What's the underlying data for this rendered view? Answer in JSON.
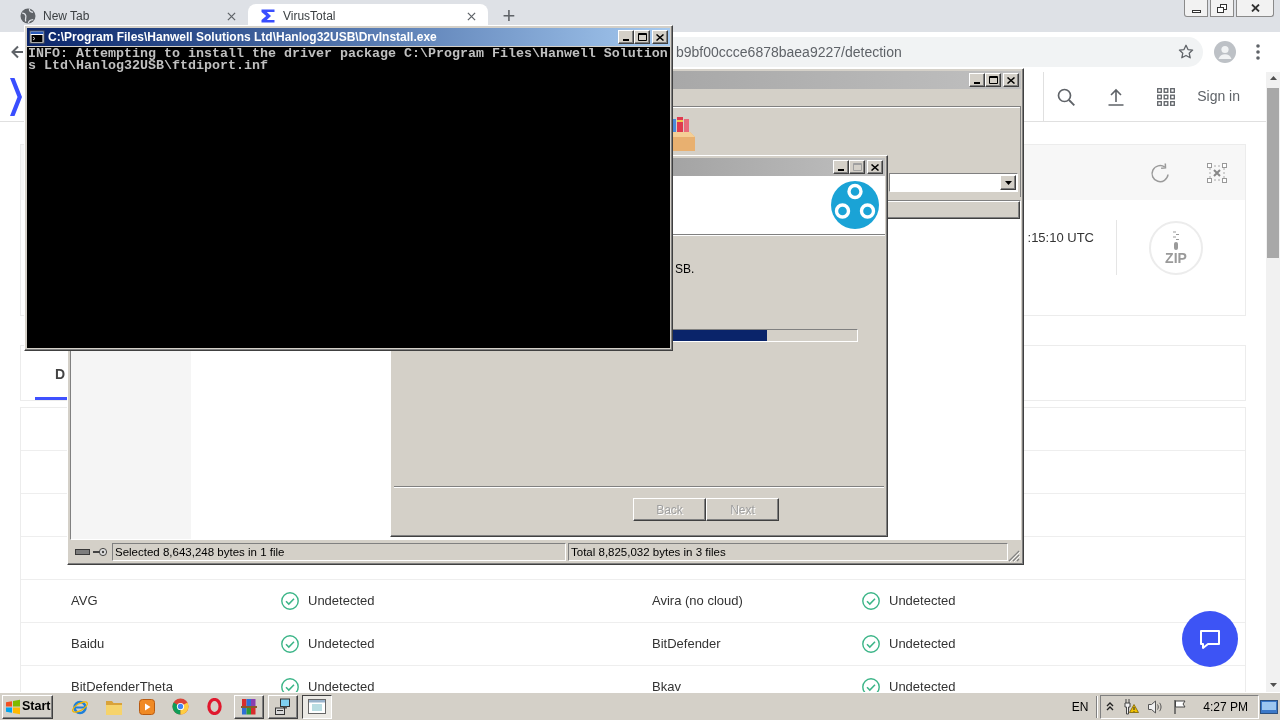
{
  "browser": {
    "tabs": [
      {
        "title": "New Tab",
        "selected": false
      },
      {
        "title": "VirusTotal",
        "selected": true
      }
    ],
    "new_tab": "+",
    "url": "b9bf00ccce6878baea9227/detection"
  },
  "page": {
    "sign_in": "Sign in",
    "summary": {
      "date": ":15:10 UTC",
      "file_type": "ZIP"
    },
    "tabs": [
      {
        "label": "D",
        "selected": true
      }
    ],
    "results": [
      {
        "cells": [
          {
            "engine": "AVG",
            "result": "Undetected"
          },
          {
            "engine": "Avira (no cloud)",
            "result": "Undetected"
          }
        ]
      },
      {
        "cells": [
          {
            "engine": "Baidu",
            "result": "Undetected"
          },
          {
            "engine": "BitDefender",
            "result": "Undetected"
          }
        ]
      },
      {
        "cells": [
          {
            "engine": "BitDefenderTheta",
            "result": "Undetected"
          },
          {
            "engine": "Bkav",
            "result": "Undetected"
          }
        ]
      }
    ]
  },
  "archive_window": {
    "active": false,
    "status": [
      "Selected 8,643,248 bytes in 1 file",
      "Total 8,825,032 bytes in 3 files"
    ]
  },
  "installer_window": {
    "active": false,
    "maximize_disabled": true,
    "message": "SB.",
    "progress": {
      "level": 0.51
    },
    "buttons": [
      {
        "label": "Back",
        "disabled": true
      },
      {
        "label": "Next",
        "disabled": true
      }
    ]
  },
  "console_window": {
    "active": true,
    "title": "C:\\Program Files\\Hanwell Solutions Ltd\\Hanlog32USB\\DrvInstall.exe",
    "lines": [
      "INFO: Attempting to install the driver package C:\\Program Files\\Hanwell Solution",
      "s Ltd\\Hanlog32USB\\ftdiport.inf"
    ]
  },
  "taskbar": {
    "start": "Start",
    "apps": [
      {
        "kind": "launcher",
        "selected": false
      },
      {
        "kind": "launcher",
        "selected": false
      },
      {
        "kind": "launcher",
        "selected": false
      },
      {
        "kind": "launcher",
        "selected": false
      },
      {
        "kind": "launcher",
        "selected": false
      },
      {
        "kind": "window",
        "selected": false
      },
      {
        "kind": "window",
        "selected": false
      },
      {
        "kind": "window",
        "selected": true
      }
    ],
    "language": "EN",
    "clock": "4:27 PM"
  }
}
